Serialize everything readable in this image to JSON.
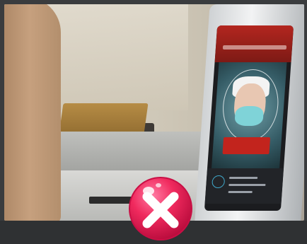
{
  "scene": {
    "description_icons": [
      "face-recognition-kiosk",
      "reject-x-icon"
    ],
    "colors": {
      "reject_red": "#e8174e",
      "kiosk_screen_red": "#b3261f",
      "mask_teal": "#7fd3d8"
    }
  }
}
